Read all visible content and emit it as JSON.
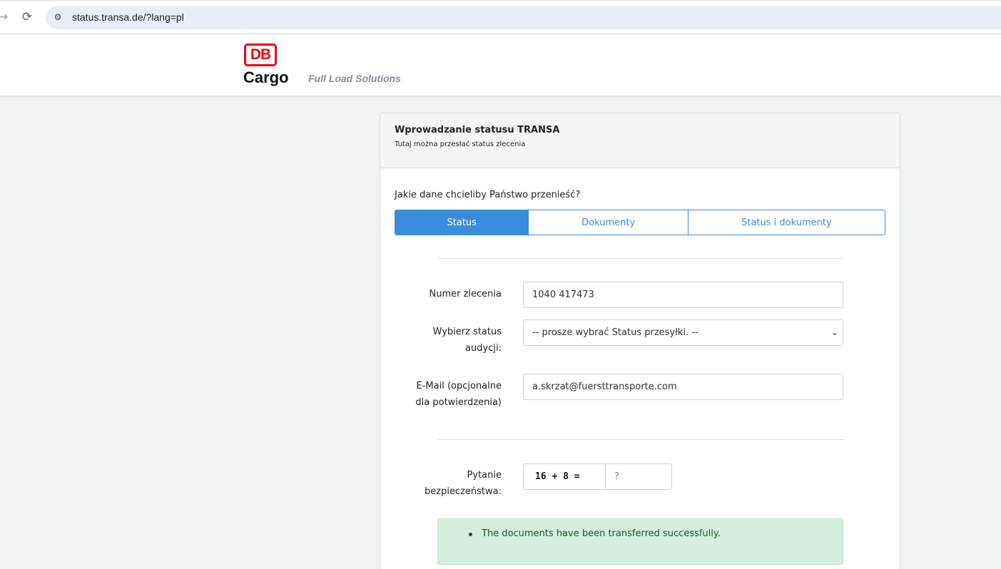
{
  "browser": {
    "url": "status.transa.de/?lang=pl",
    "back_icon": "arrow-back-icon",
    "reload_icon": "reload-icon",
    "site_info_icon": "tune-icon"
  },
  "brand": {
    "logo_text": "DB",
    "name": "Cargo",
    "tagline": "Full Load Solutions",
    "logo_color": "#ec0016"
  },
  "card": {
    "title": "Wprowadzanie statusu TRANSA",
    "subtitle": "Tutaj można przesłać status zlecenia",
    "question": "Jakie dane chcieliby Państwo przenieść?",
    "tabs": [
      {
        "label": "Status",
        "active": true
      },
      {
        "label": "Dokumenty",
        "active": false
      },
      {
        "label": "Status i dokumenty",
        "active": false
      }
    ],
    "accent_color": "#3a8ddb"
  },
  "form": {
    "order_number": {
      "label": "Numer zlecenia",
      "value": "1040 417473"
    },
    "status": {
      "label_line1": "Wybierz status",
      "label_line2": "audycji:",
      "selected": "-- prosze wybrać Status przesyłki. --"
    },
    "email": {
      "label_line1": "E-Mail (opcjonalne",
      "label_line2": "dla potwierdzenia)",
      "value": "a.skrzat@fuersttransporte.com"
    },
    "security": {
      "label_line1": "Pytanie",
      "label_line2": "bezpieczeństwa:",
      "question": "16 + 8 =",
      "placeholder": "?"
    }
  },
  "alert": {
    "message": "The documents have been transferred successfully.",
    "color": "#d4efdf"
  }
}
